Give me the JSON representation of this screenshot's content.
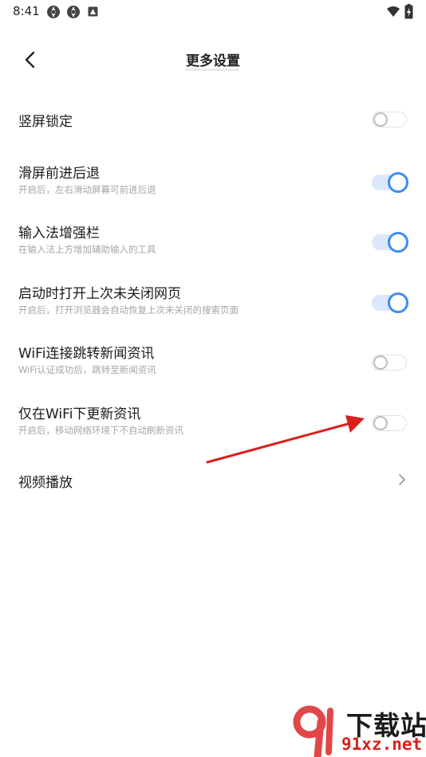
{
  "status_bar": {
    "time": "8:41",
    "left_icons": [
      "app-notification-icon",
      "app-notification-icon",
      "photo-notification-icon"
    ],
    "right_icons": [
      "wifi-icon",
      "battery-charging-icon"
    ]
  },
  "header": {
    "title": "更多设置",
    "back_icon": "chevron-left-icon"
  },
  "settings": [
    {
      "label": "竖屏锁定",
      "subtitle": "",
      "control": "toggle",
      "checked": false
    },
    {
      "label": "滑屏前进后退",
      "subtitle": "开启后，左右滑动屏幕可前进后退",
      "control": "toggle",
      "checked": true
    },
    {
      "label": "输入法增强栏",
      "subtitle": "在输入法上方增加辅助输入的工具",
      "control": "toggle",
      "checked": true
    },
    {
      "label": "启动时打开上次未关闭网页",
      "subtitle": "开启后，打开浏览器会自动恢复上次未关闭的搜索页面",
      "control": "toggle",
      "checked": true
    },
    {
      "label": "WiFi连接跳转新闻资讯",
      "subtitle": "WiFi认证成功后，跳转至新闻资讯",
      "control": "toggle",
      "checked": false
    },
    {
      "label": "仅在WiFi下更新资讯",
      "subtitle": "开启后，移动网络环境下不自动刷新资讯",
      "control": "toggle",
      "checked": false
    },
    {
      "label": "视频播放",
      "subtitle": "",
      "control": "chevron"
    }
  ],
  "colors": {
    "toggle_on_knob": "#3f8cf4",
    "toggle_on_track": "#dce8fc",
    "toggle_off_border": "#bdbdbd",
    "annotation_arrow": "#d8201d"
  },
  "watermark": {
    "logo_icon": "91-logo-icon",
    "text": "下载站",
    "url": "91xz.net"
  }
}
